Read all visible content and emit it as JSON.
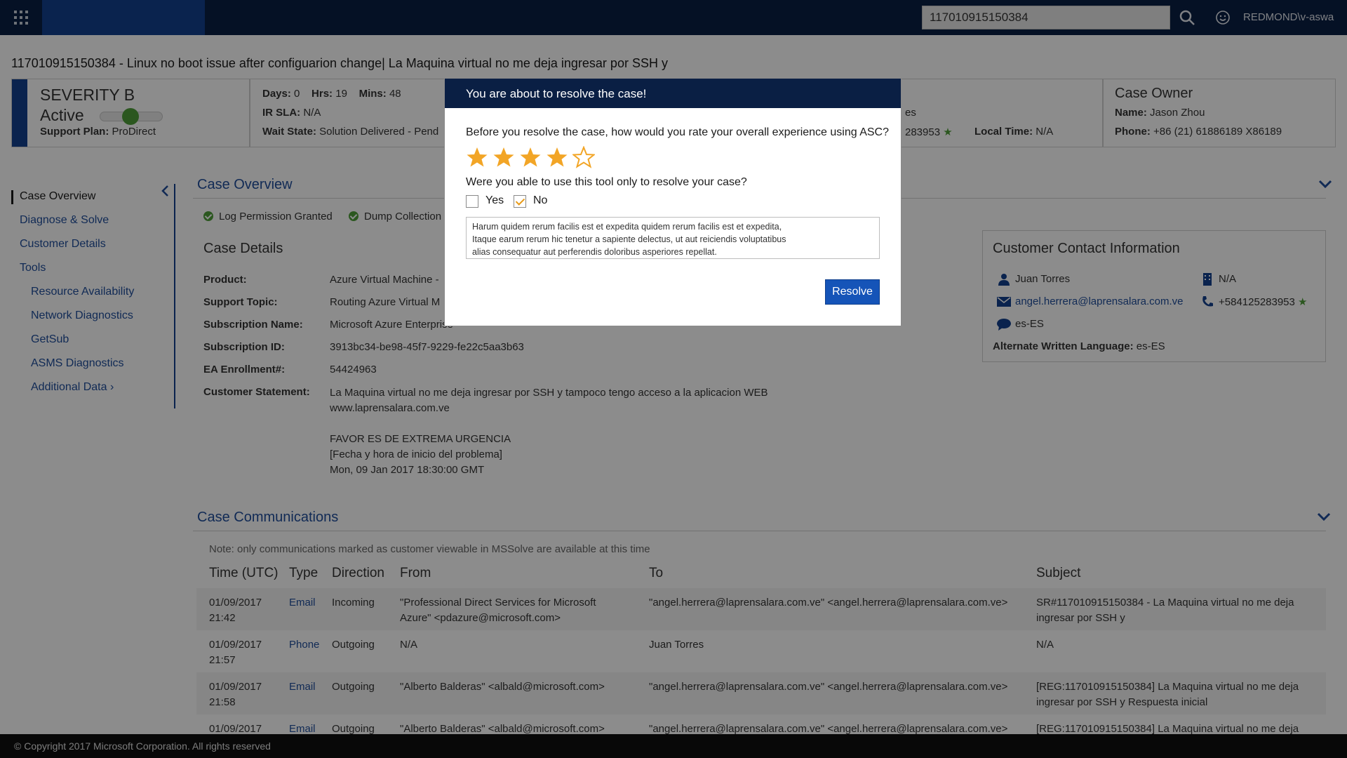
{
  "topbar": {
    "search_value": "117010915150384",
    "user_name": "REDMOND\\v-aswa",
    "icons": [
      "apps-grid-icon",
      "search-icon",
      "smiley-icon"
    ]
  },
  "case_title": "117010915150384 - Linux no boot issue after configuarion change| La Maquina virtual no me deja ingresar por SSH y",
  "header": {
    "severity": "SEVERITY B",
    "status": "Active",
    "support_plan_label": "Support Plan:",
    "support_plan": "ProDirect",
    "days_label": "Days:",
    "days": "0",
    "hrs_label": "Hrs:",
    "hrs": "19",
    "mins_label": "Mins:",
    "mins": "48",
    "ir_sla_label": "IR SLA:",
    "ir_sla": "N/A",
    "wait_state_label": "Wait State:",
    "wait_state": "Solution Delivered - Pend",
    "partial_lang": "es",
    "partial_phone": "283953",
    "local_time_label": "Local Time:",
    "local_time": "N/A",
    "owner_title": "Case Owner",
    "owner_name_label": "Name:",
    "owner_name": "Jason Zhou",
    "owner_phone_label": "Phone:",
    "owner_phone": "+86 (21) 61886189 X86189"
  },
  "nav": {
    "items": [
      {
        "label": "Case Overview"
      },
      {
        "label": "Diagnose & Solve"
      },
      {
        "label": "Customer Details"
      },
      {
        "label": "Tools"
      },
      {
        "label": "Resource Availability"
      },
      {
        "label": "Network Diagnostics"
      },
      {
        "label": "GetSub"
      },
      {
        "label": "ASMS Diagnostics"
      },
      {
        "label": "Additional Data"
      }
    ]
  },
  "overview": {
    "title": "Case Overview",
    "permissions": [
      "Log Permission Granted",
      "Dump Collection"
    ],
    "details_title": "Case Details",
    "details": [
      {
        "label": "Product:",
        "value": "Azure Virtual Machine -"
      },
      {
        "label": "Support Topic:",
        "value": "Routing Azure Virtual M"
      },
      {
        "label": "Subscription Name:",
        "value": "Microsoft Azure Enterprise"
      },
      {
        "label": "Subscription ID:",
        "value": "3913bc34-be98-45f7-9229-fe22c5aa3b63"
      },
      {
        "label": "EA Enrollment#:",
        "value": "54424963"
      },
      {
        "label": "Customer Statement:",
        "value": ""
      }
    ],
    "statement_lines": [
      "La Maquina virtual no me deja ingresar por SSH y tampoco tengo acceso a la aplicacion WEB",
      "www.laprensalara.com.ve",
      "",
      "FAVOR ES DE EXTREMA URGENCIA",
      "[Fecha y hora de inicio del problema]",
      "Mon, 09 Jan 2017 18:30:00 GMT"
    ]
  },
  "contact": {
    "title": "Customer Contact Information",
    "name": "Juan Torres",
    "org": "N/A",
    "email": "angel.herrera@laprensalara.com.ve",
    "phone": "+584125283953",
    "language": "es-ES",
    "alt_lang_label": "Alternate Written Language:",
    "alt_lang": "es-ES"
  },
  "communications": {
    "title": "Case Communications",
    "note": "Note: only communications marked as customer viewable in MSSolve are available at this time",
    "columns": [
      "Time (UTC)",
      "Type",
      "Direction",
      "From",
      "To",
      "Subject"
    ],
    "rows": [
      {
        "date": "01/09/2017",
        "time": "21:42",
        "type": "Email",
        "direction": "Incoming",
        "from1": "\"Professional Direct Services for Microsoft",
        "from2": "Azure\" <pdazure@microsoft.com>",
        "to": "\"angel.herrera@laprensalara.com.ve\" <angel.herrera@laprensalara.com.ve>",
        "subj1": "SR#117010915150384 - La Maquina virtual no me deja",
        "subj2": "ingresar por SSH y"
      },
      {
        "date": "01/09/2017",
        "time": "21:57",
        "type": "Phone",
        "direction": "Outgoing",
        "from1": "N/A",
        "from2": "",
        "to": "Juan Torres",
        "subj1": "N/A",
        "subj2": ""
      },
      {
        "date": "01/09/2017",
        "time": "21:58",
        "type": "Email",
        "direction": "Outgoing",
        "from1": "\"Alberto Balderas\" <albald@microsoft.com>",
        "from2": "",
        "to": "\"angel.herrera@laprensalara.com.ve\" <angel.herrera@laprensalara.com.ve>",
        "subj1": "[REG:117010915150384] La Maquina virtual no me deja",
        "subj2": "ingresar por SSH y Respuesta inicial"
      },
      {
        "date": "01/09/2017",
        "time": "",
        "type": "Email",
        "direction": "Outgoing",
        "from1": "\"Alberto Balderas\" <albald@microsoft.com>",
        "from2": "",
        "to": "\"angel.herrera@laprensalara.com.ve\" <angel.herrera@laprensalara.com.ve>",
        "subj1": "[REG:117010915150384] La Maquina virtual no me deja",
        "subj2": ""
      }
    ]
  },
  "modal": {
    "title": "You are about to resolve the case!",
    "question1": "Before you resolve the case, how would you rate your overall experience using ASC?",
    "rating": 4,
    "rating_max": 5,
    "question2": "Were you able to use this tool only to resolve your case?",
    "yes_label": "Yes",
    "no_label": "No",
    "yes_checked": false,
    "no_checked": true,
    "comment": "Harum quidem rerum facilis est et expedita quidem rerum facilis est et expedita,\nItaque earum rerum hic tenetur a sapiente delectus, ut aut reiciendis voluptatibus\nalias consequatur aut perferendis doloribus asperiores repellat.",
    "resolve_label": "Resolve"
  },
  "footer": {
    "copyright": "© Copyright 2017 Microsoft Corporation. All rights reserved"
  },
  "colors": {
    "topbar": "#0a1f44",
    "accent_blue": "#13408f",
    "link_blue": "#1f4e9c",
    "star_orange": "#f2a526",
    "success_green": "#4f9f3a"
  }
}
